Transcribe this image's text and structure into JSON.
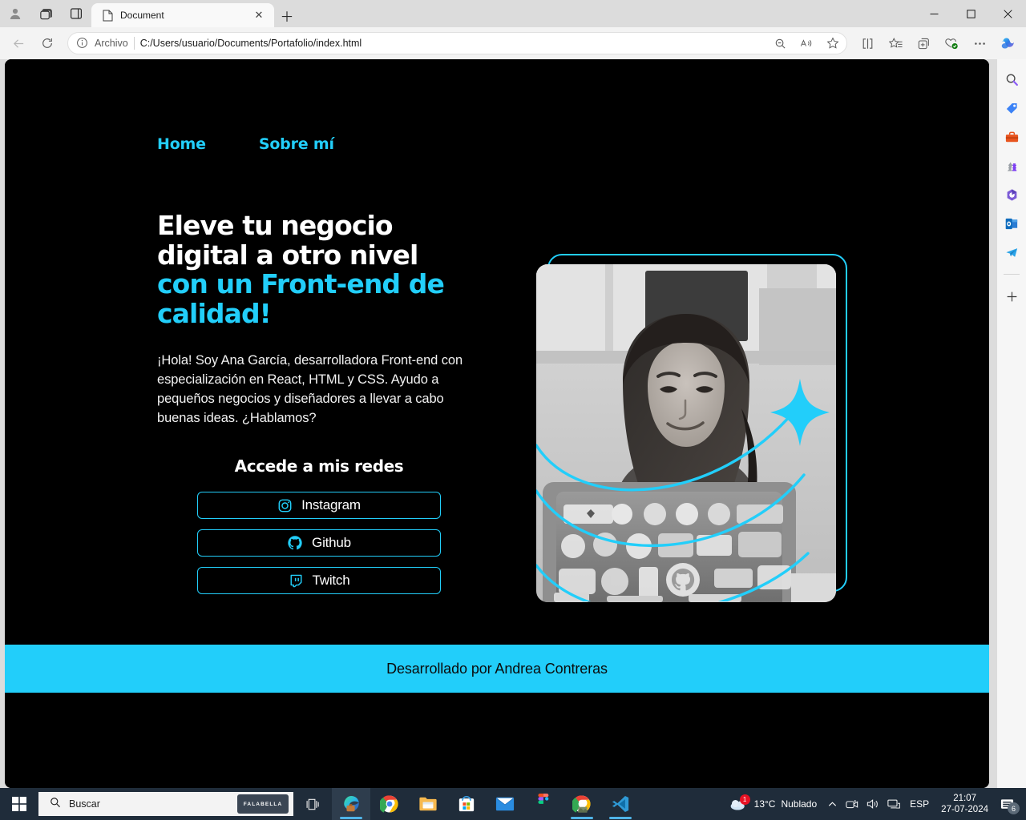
{
  "browser": {
    "name": "Microsoft Edge",
    "tab": {
      "title": "Document",
      "favicon_icon": "document-icon",
      "close_icon": "close-icon"
    },
    "new_tab_icon": "plus-icon",
    "system_icons": [
      "profile-icon",
      "workspaces-icon",
      "tab-actions-icon"
    ],
    "window_controls": {
      "minimize": "minimize-icon",
      "maximize": "maximize-icon",
      "close": "close-icon"
    },
    "nav": {
      "back_icon": "back-arrow-icon",
      "refresh_icon": "refresh-icon",
      "info_icon": "info-icon",
      "scheme_label": "Archivo",
      "url": "C:/Users/usuario/Documents/Portafolio/index.html",
      "right_icons": [
        "zoom-out-icon",
        "read-aloud-icon",
        "favorite-star-icon",
        "split-screen-icon",
        "collections-star-icon",
        "add-to-collections-icon",
        "browser-essentials-icon",
        "settings-more-icon",
        "copilot-icon"
      ]
    },
    "sidebar_icons": [
      "search-icon",
      "shopping-tag-icon",
      "tools-icon",
      "games-icon",
      "microsoft-365-icon",
      "outlook-icon",
      "telegram-icon",
      "add-sidebar-icon",
      "sidebar-settings-icon"
    ]
  },
  "page": {
    "background": "#000000",
    "accent": "#22cefa",
    "nav": [
      {
        "label": "Home",
        "name": "nav-link-home"
      },
      {
        "label": "Sobre mí",
        "name": "nav-link-sobre-mi"
      }
    ],
    "headline": {
      "line1": "Eleve tu negocio",
      "line2": "digital a otro nivel",
      "accent1": "con un Front-end de",
      "accent2": "calidad!"
    },
    "bio": "¡Hola! Soy Ana García, desarrolladora Front-end con especialización en React, HTML y CSS. Ayudo a pequeños negocios y diseñadores a llevar a cabo buenas ideas. ¿Hablamos?",
    "social_title": "Accede a mis redes",
    "social": [
      {
        "label": "Instagram",
        "icon": "instagram-icon",
        "name": "social-button-instagram"
      },
      {
        "label": "Github",
        "icon": "github-icon",
        "name": "social-button-github"
      },
      {
        "label": "Twitch",
        "icon": "twitch-icon",
        "name": "social-button-twitch"
      }
    ],
    "photo": {
      "alt": "Desarrolladora sonriendo frente a un portátil cubierto de stickers",
      "decorations": [
        "cyan-outline-frame",
        "cyan-arc-top",
        "cyan-arc-middle",
        "cyan-arc-bottom",
        "cyan-sparkle"
      ]
    },
    "footer": {
      "text": "Desarrollado por Andrea Contreras",
      "background": "#22cefa"
    }
  },
  "taskbar": {
    "start_icon": "windows-start-icon",
    "search": {
      "placeholder": "Buscar",
      "icon": "search-icon",
      "promo_label": "FALABELLA"
    },
    "apps": [
      {
        "name": "taskbar-task-view",
        "icon": "task-view-icon"
      },
      {
        "name": "taskbar-edge",
        "icon": "edge-icon"
      },
      {
        "name": "taskbar-chrome",
        "icon": "chrome-icon"
      },
      {
        "name": "taskbar-file-explorer",
        "icon": "file-explorer-icon"
      },
      {
        "name": "taskbar-microsoft-store",
        "icon": "microsoft-store-icon"
      },
      {
        "name": "taskbar-mail",
        "icon": "mail-icon"
      },
      {
        "name": "taskbar-figma",
        "icon": "figma-icon"
      },
      {
        "name": "taskbar-chrome-2",
        "icon": "chrome-icon"
      },
      {
        "name": "taskbar-vscode",
        "icon": "vscode-icon"
      }
    ],
    "tray": {
      "weather_temp": "13°C",
      "weather_desc": "Nublado",
      "show_hidden_icon": "chevron-up-icon",
      "icons": [
        "camera-icon",
        "volume-icon",
        "network-icon"
      ],
      "language": "ESP",
      "time": "21:07",
      "date": "27-07-2024",
      "notifications_icon": "notifications-icon",
      "notifications_count": "6"
    }
  }
}
